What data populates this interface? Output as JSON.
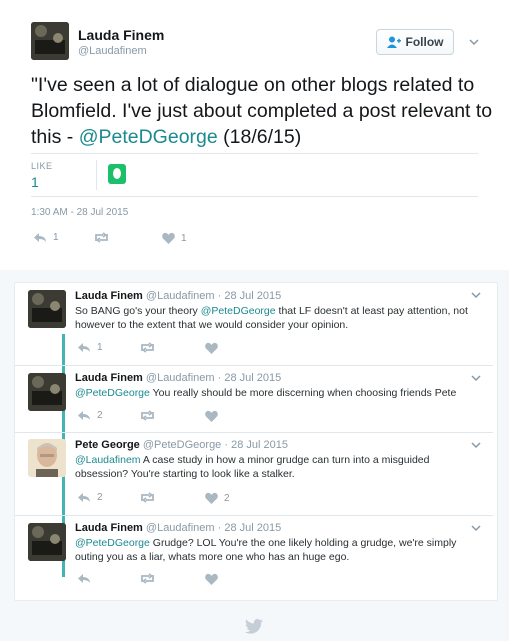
{
  "main_tweet": {
    "name": "Lauda Finem",
    "handle": "@Laudafinem",
    "follow_label": "Follow",
    "text_before": "\"I've seen a lot of dialogue on other blogs related to Blomfield. I've just about completed a post relevant to this - ",
    "mention": "@PeteDGeorge",
    "text_after": " (18/6/15)",
    "like_label": "LIKE",
    "like_count": "1",
    "timestamp": "1:30 AM - 28 Jul 2015",
    "actions": {
      "reply_count": "1",
      "like_count": "1"
    }
  },
  "replies": [
    {
      "name": "Lauda Finem",
      "handle": "@Laudafinem",
      "date": "· 28 Jul 2015",
      "text_before": "So BANG go's your theory ",
      "mention": "@PeteDGeorge",
      "text_after": " that LF doesn't at least pay attention, not however to the extent that we would consider your opinion.",
      "reply_count": "1",
      "like_count": ""
    },
    {
      "name": "Lauda Finem",
      "handle": "@Laudafinem",
      "date": "· 28 Jul 2015",
      "text_before": "",
      "mention": "@PeteDGeorge",
      "text_after": " You really should be more discerning when choosing friends Pete",
      "reply_count": "2",
      "like_count": ""
    },
    {
      "name": "Pete George",
      "handle": "@PeteDGeorge",
      "date": "· 28 Jul 2015",
      "text_before": "",
      "mention": "@Laudafinem",
      "text_after": " A case study in how a minor grudge can turn into a misguided obsession? You're starting to look like a stalker.",
      "reply_count": "2",
      "like_count": "2"
    },
    {
      "name": "Lauda Finem",
      "handle": "@Laudafinem",
      "date": "· 28 Jul 2015",
      "text_before": "",
      "mention": "@PeteDGeorge",
      "text_after": " Grudge? LOL You're the one likely holding a grudge, we're simply outing you as a liar, whats more one who has an huge ego.",
      "reply_count": "",
      "like_count": ""
    }
  ],
  "colors": {
    "accent": "#1b8a8f",
    "thread_line": "#45b2b4",
    "muted": "#8899a6"
  }
}
